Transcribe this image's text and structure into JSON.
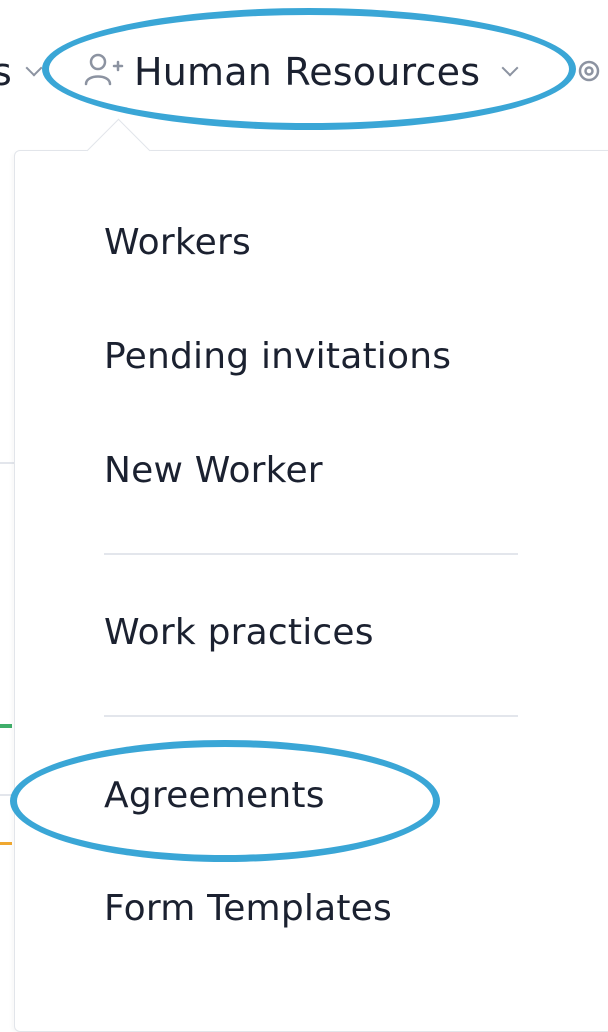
{
  "nav": {
    "prev_item_label": "s",
    "human_resources_label": "Human Resources",
    "icons": {
      "human_resources": "person-add-icon",
      "chevron": "chevron-down-icon",
      "next_item": "gear-icon"
    }
  },
  "dropdown": {
    "items": [
      {
        "label": "Workers"
      },
      {
        "label": "Pending invitations"
      },
      {
        "label": "New Worker"
      },
      {
        "label": "Work practices"
      },
      {
        "label": "Agreements"
      },
      {
        "label": "Form Templates"
      }
    ]
  },
  "colors": {
    "annotation": "#3aa6d6",
    "text": "#1b2130",
    "icon": "#8c93a1",
    "divider": "#e3e6ec",
    "accent_green": "#3fae6a",
    "accent_orange": "#f0a830"
  }
}
